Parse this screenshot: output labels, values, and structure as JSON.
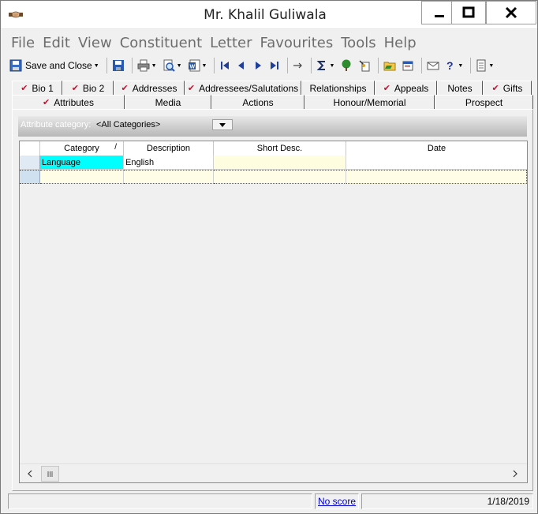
{
  "window": {
    "title": "Mr. Khalil Guliwala"
  },
  "menu": [
    "File",
    "Edit",
    "View",
    "Constituent",
    "Letter",
    "Favourites",
    "Tools",
    "Help"
  ],
  "toolbar": {
    "save_close_label": "Save and Close"
  },
  "tabs_row1": [
    {
      "label": "Bio 1",
      "checked": true
    },
    {
      "label": "Bio 2",
      "checked": true
    },
    {
      "label": "Addresses",
      "checked": true
    },
    {
      "label": "Addressees/Salutations",
      "checked": true
    },
    {
      "label": "Relationships",
      "checked": false
    },
    {
      "label": "Appeals",
      "checked": true
    },
    {
      "label": "Notes",
      "checked": false
    },
    {
      "label": "Gifts",
      "checked": true
    }
  ],
  "tabs_row2": [
    {
      "label": "Attributes",
      "checked": true
    },
    {
      "label": "Media",
      "checked": false
    },
    {
      "label": "Actions",
      "checked": false
    },
    {
      "label": "Honour/Memorial",
      "checked": false
    },
    {
      "label": "Prospect",
      "checked": false
    }
  ],
  "filter": {
    "label": "Attribute category:",
    "value": "<All Categories>"
  },
  "grid": {
    "columns": [
      "Category",
      "Description",
      "Short Desc.",
      "Date"
    ],
    "sort_indicator": "/",
    "rows": [
      {
        "category": "Language",
        "description": "English",
        "short_desc": "",
        "date": ""
      },
      {
        "category": "",
        "description": "",
        "short_desc": "",
        "date": ""
      }
    ]
  },
  "status": {
    "score_link": "No score",
    "date": "1/18/2019"
  },
  "colors": {
    "category_highlight": "#00ffff",
    "short_desc_highlight": "#fffde0",
    "check": "#c8102e"
  }
}
